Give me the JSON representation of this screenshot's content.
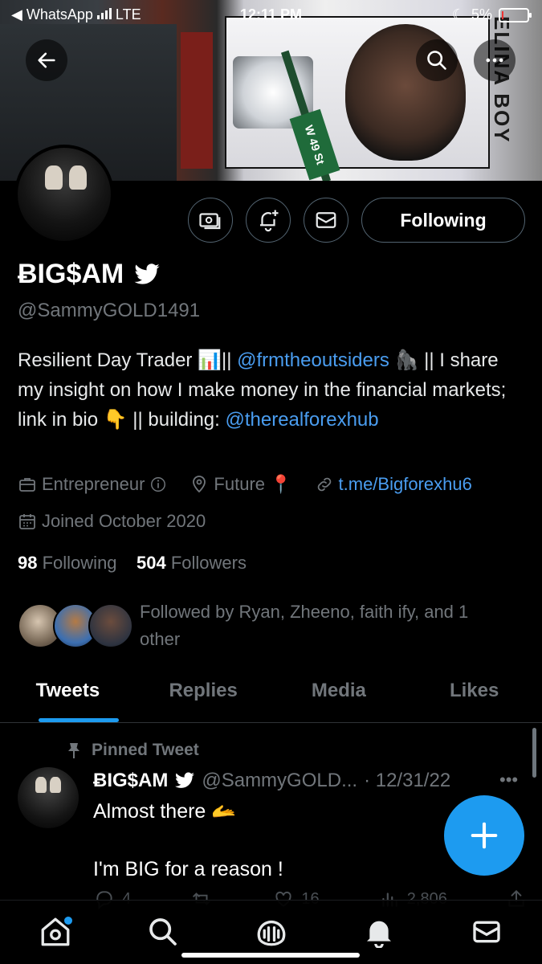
{
  "status_bar": {
    "back_app": "◀ WhatsApp",
    "network": "LTE",
    "time": "12:11 PM",
    "battery": "5%"
  },
  "banner": {
    "sign_text": "W 49 St",
    "billboard_text": "ELINA BOY"
  },
  "profile": {
    "display_name": "ɃIG$AM",
    "handle": "@SammyGOLD1491",
    "bio_part1": "Resilient Day Trader 📊|| ",
    "bio_mention1": "@frmtheoutsiders",
    "bio_part2": " 🦍 || I share my insight on how I make money in the financial markets; link in bio 👇 || building: ",
    "bio_mention2": "@therealforexhub",
    "category": "Entrepreneur",
    "location": "Future 📍",
    "website": "t.me/Bigforexhu6",
    "joined": "Joined October 2020",
    "following_count": "98",
    "following_label": "Following",
    "followers_count": "504",
    "followers_label": "Followers",
    "followed_by": "Followed by Ryan, Zheeno, faith ify, and 1 other"
  },
  "actions": {
    "following_button": "Following"
  },
  "tabs": [
    {
      "label": "Tweets",
      "active": true
    },
    {
      "label": "Replies",
      "active": false
    },
    {
      "label": "Media",
      "active": false
    },
    {
      "label": "Likes",
      "active": false
    }
  ],
  "tweet": {
    "pinned_label": "Pinned Tweet",
    "author_name": "ɃIG$AM",
    "author_handle": "@SammyGOLD...",
    "date": "· 12/31/22",
    "text": "Almost there 🫴\n\nI'm BIG for a reason !",
    "replies": "4",
    "likes": "16",
    "views": "2,806"
  },
  "colors": {
    "accent": "#1d9bf0",
    "link": "#4a9df0",
    "muted": "#71767b",
    "background": "#000000"
  },
  "icons": [
    "back-arrow-icon",
    "search-icon",
    "more-icon",
    "money-icon",
    "notification-add-icon",
    "mail-icon",
    "verified-bird-icon",
    "briefcase-icon",
    "info-icon",
    "location-icon",
    "link-icon",
    "calendar-icon",
    "pin-icon",
    "reply-icon",
    "retweet-icon",
    "like-icon",
    "views-icon",
    "share-icon",
    "plus-icon",
    "home-icon",
    "spaces-icon",
    "bell-icon"
  ]
}
